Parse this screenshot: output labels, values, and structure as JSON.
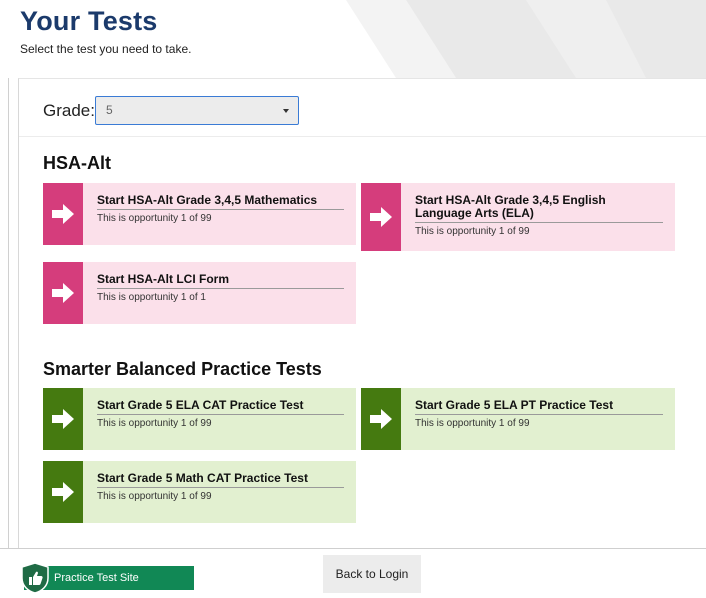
{
  "header": {
    "title": "Your Tests",
    "subtitle": "Select the test you need to take."
  },
  "grade": {
    "label": "Grade:",
    "selected": "5"
  },
  "sections": [
    {
      "title": "HSA-Alt",
      "color": "#d53d7c",
      "tiles": [
        {
          "title": "Start HSA-Alt Grade 3,4,5 Mathematics",
          "subtitle": "This is opportunity 1 of 99"
        },
        {
          "title": "Start HSA-Alt Grade 3,4,5 English Language Arts (ELA)",
          "subtitle": "This is opportunity 1 of 99"
        },
        {
          "title": "Start HSA-Alt LCI Form",
          "subtitle": "This is opportunity 1 of 1"
        }
      ]
    },
    {
      "title": "Smarter Balanced Practice Tests",
      "color": "#457a10",
      "tiles": [
        {
          "title": "Start Grade 5 ELA CAT Practice Test",
          "subtitle": "This is opportunity 1 of 99"
        },
        {
          "title": "Start Grade 5 ELA PT Practice Test",
          "subtitle": "This is opportunity 1 of 99"
        },
        {
          "title": "Start Grade 5 Math CAT Practice Test",
          "subtitle": "This is opportunity 1 of 99"
        }
      ]
    }
  ],
  "footer": {
    "site_badge": "Practice Test Site",
    "back_button": "Back to Login"
  },
  "icons": {
    "tile_arrow": "arrow-right-icon",
    "site_logo": "shield-thumbs-up-icon",
    "dropdown": "caret-down-icon"
  }
}
